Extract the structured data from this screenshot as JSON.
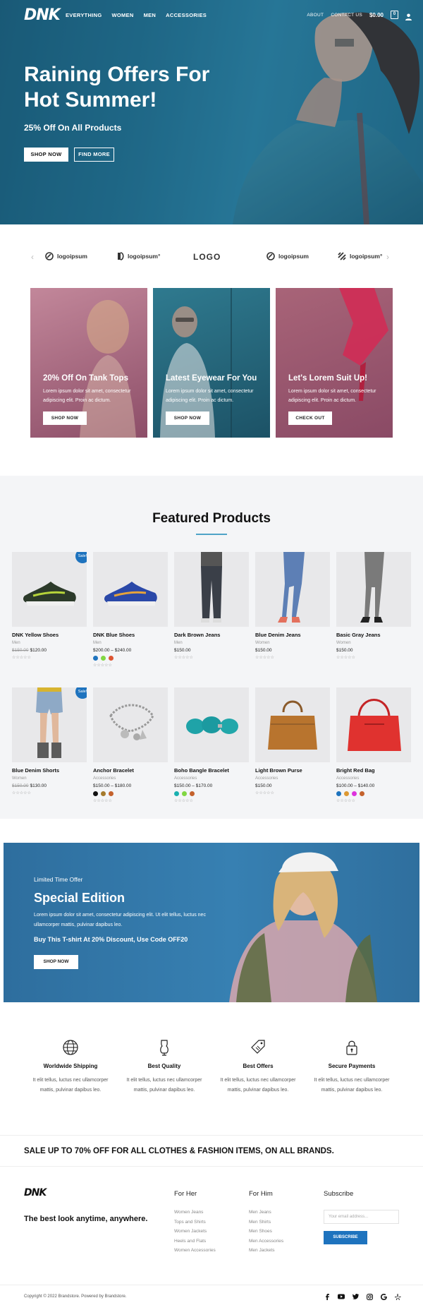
{
  "header": {
    "logo": "DNK",
    "menu": [
      "EVERYTHING",
      "WOMEN",
      "MEN",
      "ACCESSORIES"
    ],
    "links": [
      "ABOUT",
      "CONTACT US"
    ],
    "cart_total": "$0.00",
    "cart_count": "0"
  },
  "hero": {
    "title": "Raining Offers For Hot Summer!",
    "subtitle": "25% Off On All Products",
    "primary_button": "SHOP NOW",
    "secondary_button": "FIND MORE"
  },
  "brands": [
    "logoipsum",
    "logoipsum°",
    "LOGO",
    "logoipsum",
    "logoipsum°"
  ],
  "promo_cards": [
    {
      "title": "20% Off On Tank Tops",
      "text": "Lorem ipsum dolor sit amet, consectetur adipiscing elit. Proin ac dictum.",
      "button": "SHOP NOW",
      "color": "#a8627b"
    },
    {
      "title": "Latest Eyewear For You",
      "text": "Lorem ipsum dolor sit amet, consectetur adipiscing elit. Proin ac dictum.",
      "button": "SHOP NOW",
      "color": "#2a6a80"
    },
    {
      "title": "Let's Lorem Suit Up!",
      "text": "Lorem ipsum dolor sit amet, consectetur adipiscing elit. Proin ac dictum.",
      "button": "CHECK OUT",
      "color": "#9b5570"
    }
  ],
  "featured": {
    "title": "Featured Products",
    "sale_badge": "Sale!",
    "stars": "☆☆☆☆☆",
    "products": [
      {
        "name": "DNK Yellow Shoes",
        "cat": "Men",
        "old": "$150.00",
        "price": "$120.00",
        "sale": true,
        "swatches": [],
        "icon": "sneaker-yellow"
      },
      {
        "name": "DNK Blue Shoes",
        "cat": "Men",
        "old": "",
        "price": "$200.00 – $240.00",
        "sale": false,
        "swatches": [
          "#1e73be",
          "#81d742",
          "#dd5533"
        ],
        "icon": "sneaker-blue"
      },
      {
        "name": "Dark Brown Jeans",
        "cat": "Men",
        "old": "",
        "price": "$150.00",
        "sale": false,
        "swatches": [],
        "icon": "jeans-dark"
      },
      {
        "name": "Blue Denim Jeans",
        "cat": "Women",
        "old": "",
        "price": "$150.00",
        "sale": false,
        "swatches": [],
        "icon": "jeans-blue"
      },
      {
        "name": "Basic Gray Jeans",
        "cat": "Women",
        "old": "",
        "price": "$150.00",
        "sale": false,
        "swatches": [],
        "icon": "jeans-gray"
      },
      {
        "name": "Blue Denim Shorts",
        "cat": "Women",
        "old": "$150.00",
        "price": "$130.00",
        "sale": true,
        "swatches": [],
        "icon": "shorts"
      },
      {
        "name": "Anchor Bracelet",
        "cat": "Accessories",
        "old": "",
        "price": "$150.00 – $180.00",
        "sale": false,
        "swatches": [
          "#111111",
          "#a57a2c",
          "#c4622d"
        ],
        "icon": "bracelet-silver"
      },
      {
        "name": "Boho Bangle Bracelet",
        "cat": "Accessories",
        "old": "",
        "price": "$150.00 – $170.00",
        "sale": false,
        "swatches": [
          "#1ab0b0",
          "#81d742",
          "#c4622d"
        ],
        "icon": "bracelet-turquoise"
      },
      {
        "name": "Light Brown Purse",
        "cat": "Accessories",
        "old": "",
        "price": "$150.00",
        "sale": false,
        "swatches": [],
        "icon": "purse-brown"
      },
      {
        "name": "Bright Red Bag",
        "cat": "Accessories",
        "old": "",
        "price": "$100.00 – $140.00",
        "sale": false,
        "swatches": [
          "#1e73be",
          "#dd9933",
          "#dd33dd",
          "#c4622d"
        ],
        "icon": "bag-red"
      }
    ]
  },
  "special": {
    "eyebrow": "Limited Time Offer",
    "title": "Special Edition",
    "text": "Lorem ipsum dolor sit amet, consectetur adipiscing elit. Ut elit tellus, luctus nec ullamcorper mattis, pulvinar dapibus leo.",
    "code_text": "Buy This T-shirt At 20% Discount, Use Code OFF20",
    "button": "SHOP NOW"
  },
  "features": [
    {
      "title": "Worldwide Shipping",
      "text": "It elit tellus, luctus nec ullamcorper mattis, pulvinar dapibus leo.",
      "icon": "globe-icon"
    },
    {
      "title": "Best Quality",
      "text": "It elit tellus, luctus nec ullamcorper mattis, pulvinar dapibus leo.",
      "icon": "dress-form-icon"
    },
    {
      "title": "Best Offers",
      "text": "It elit tellus, luctus nec ullamcorper mattis, pulvinar dapibus leo.",
      "icon": "price-tag-icon"
    },
    {
      "title": "Secure Payments",
      "text": "It elit tellus, luctus nec ullamcorper mattis, pulvinar dapibus leo.",
      "icon": "padlock-icon"
    }
  ],
  "sale_banner": "SALE UP TO 70% OFF FOR ALL CLOTHES & FASHION ITEMS, ON ALL BRANDS.",
  "footer": {
    "logo": "DNK",
    "tagline": "The best look anytime, anywhere.",
    "for_her": {
      "title": "For Her",
      "links": [
        "Women Jeans",
        "Tops and Shirts",
        "Women Jackets",
        "Heels and Flats",
        "Women Accessories"
      ]
    },
    "for_him": {
      "title": "For Him",
      "links": [
        "Men Jeans",
        "Men Shirts",
        "Men Shoes",
        "Men Accessories",
        "Men Jackets"
      ]
    },
    "subscribe": {
      "title": "Subscribe",
      "placeholder": "Your email address...",
      "button": "SUBSCRIBE"
    },
    "copyright": "Copyright © 2022 Brandstore. Powered by Brandstore.",
    "social": [
      "facebook-icon",
      "youtube-icon",
      "twitter-icon",
      "instagram-icon",
      "google-icon",
      "yelp-icon"
    ]
  }
}
